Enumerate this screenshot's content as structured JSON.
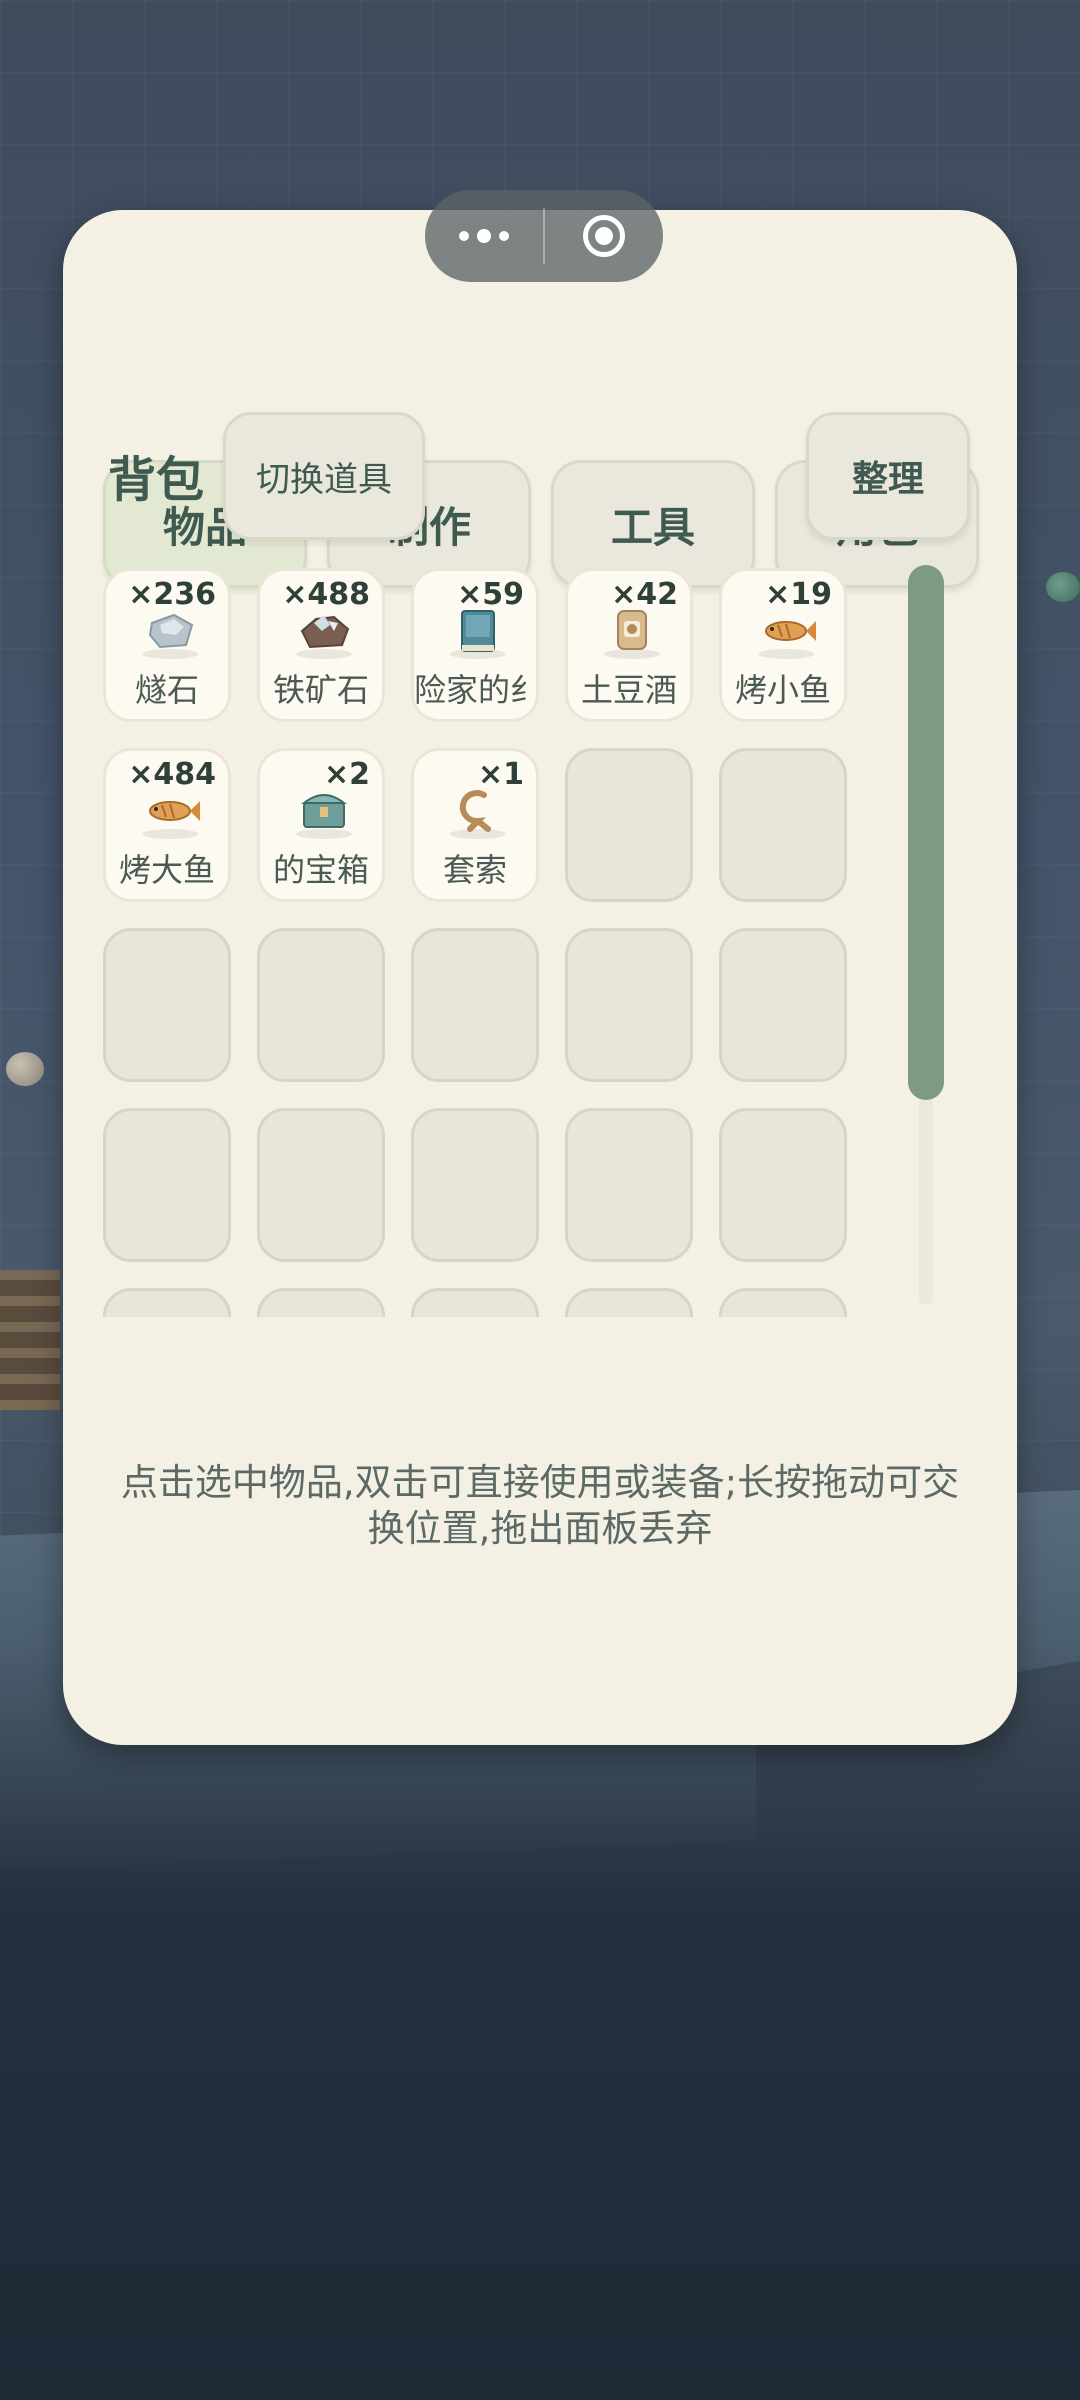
{
  "tabs": [
    {
      "label": "物品",
      "active": true
    },
    {
      "label": "制作",
      "active": false
    },
    {
      "label": "工具",
      "active": false
    },
    {
      "label": "角色",
      "active": false
    }
  ],
  "inventory": {
    "title": "背包",
    "switch_label": "切换道具",
    "sort_label": "整理",
    "slots": [
      {
        "name": "燧石",
        "count": "×236",
        "icon": "flint-icon"
      },
      {
        "name": "铁矿石",
        "count": "×488",
        "icon": "iron-ore-icon"
      },
      {
        "name": "险家的纟",
        "count": "×59",
        "icon": "book-icon"
      },
      {
        "name": "土豆酒",
        "count": "×42",
        "icon": "potato-wine-icon"
      },
      {
        "name": "烤小鱼",
        "count": "×19",
        "icon": "grilled-fish-icon"
      },
      {
        "name": "烤大鱼",
        "count": "×484",
        "icon": "grilled-fish-icon"
      },
      {
        "name": "的宝箱",
        "count": "×2",
        "icon": "treasure-chest-icon"
      },
      {
        "name": "套索",
        "count": "×1",
        "icon": "lasso-icon"
      }
    ]
  },
  "hint": "点击选中物品,双击可直接使用或装备;长按拖动可交换位置,拖出面板丢弃",
  "colors": {
    "panel_bg": "#f4f1e4",
    "text_primary": "#3f5a50",
    "scroll_thumb": "#7d9a84",
    "active_tab": "#e3e8d2"
  }
}
